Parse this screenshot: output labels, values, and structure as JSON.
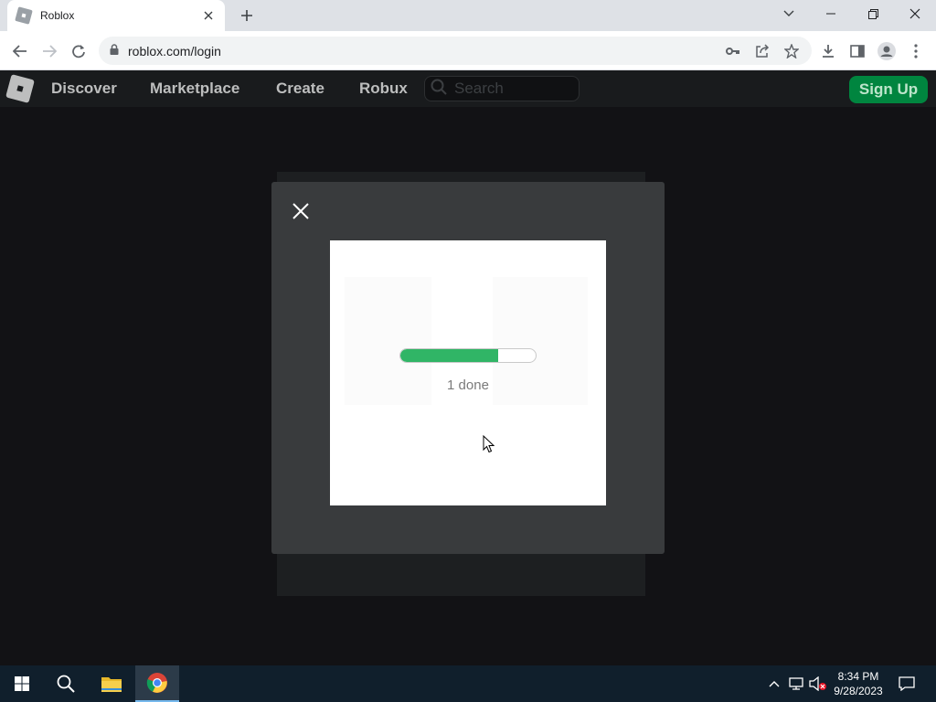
{
  "browser": {
    "tab_title": "Roblox",
    "url": "roblox.com/login"
  },
  "navbar": {
    "links": [
      "Discover",
      "Marketplace",
      "Create",
      "Robux"
    ],
    "search_placeholder": "Search",
    "signup_label": "Sign Up"
  },
  "modal": {
    "progress_fraction": 0.72,
    "progress_label": "1 done"
  },
  "taskbar": {
    "time": "8:34 PM",
    "date": "9/28/2023"
  },
  "colors": {
    "roblox_green": "#00853f",
    "progress_green": "#30b566",
    "modal_bg": "#393b3d",
    "nav_bg": "#191b1d"
  }
}
